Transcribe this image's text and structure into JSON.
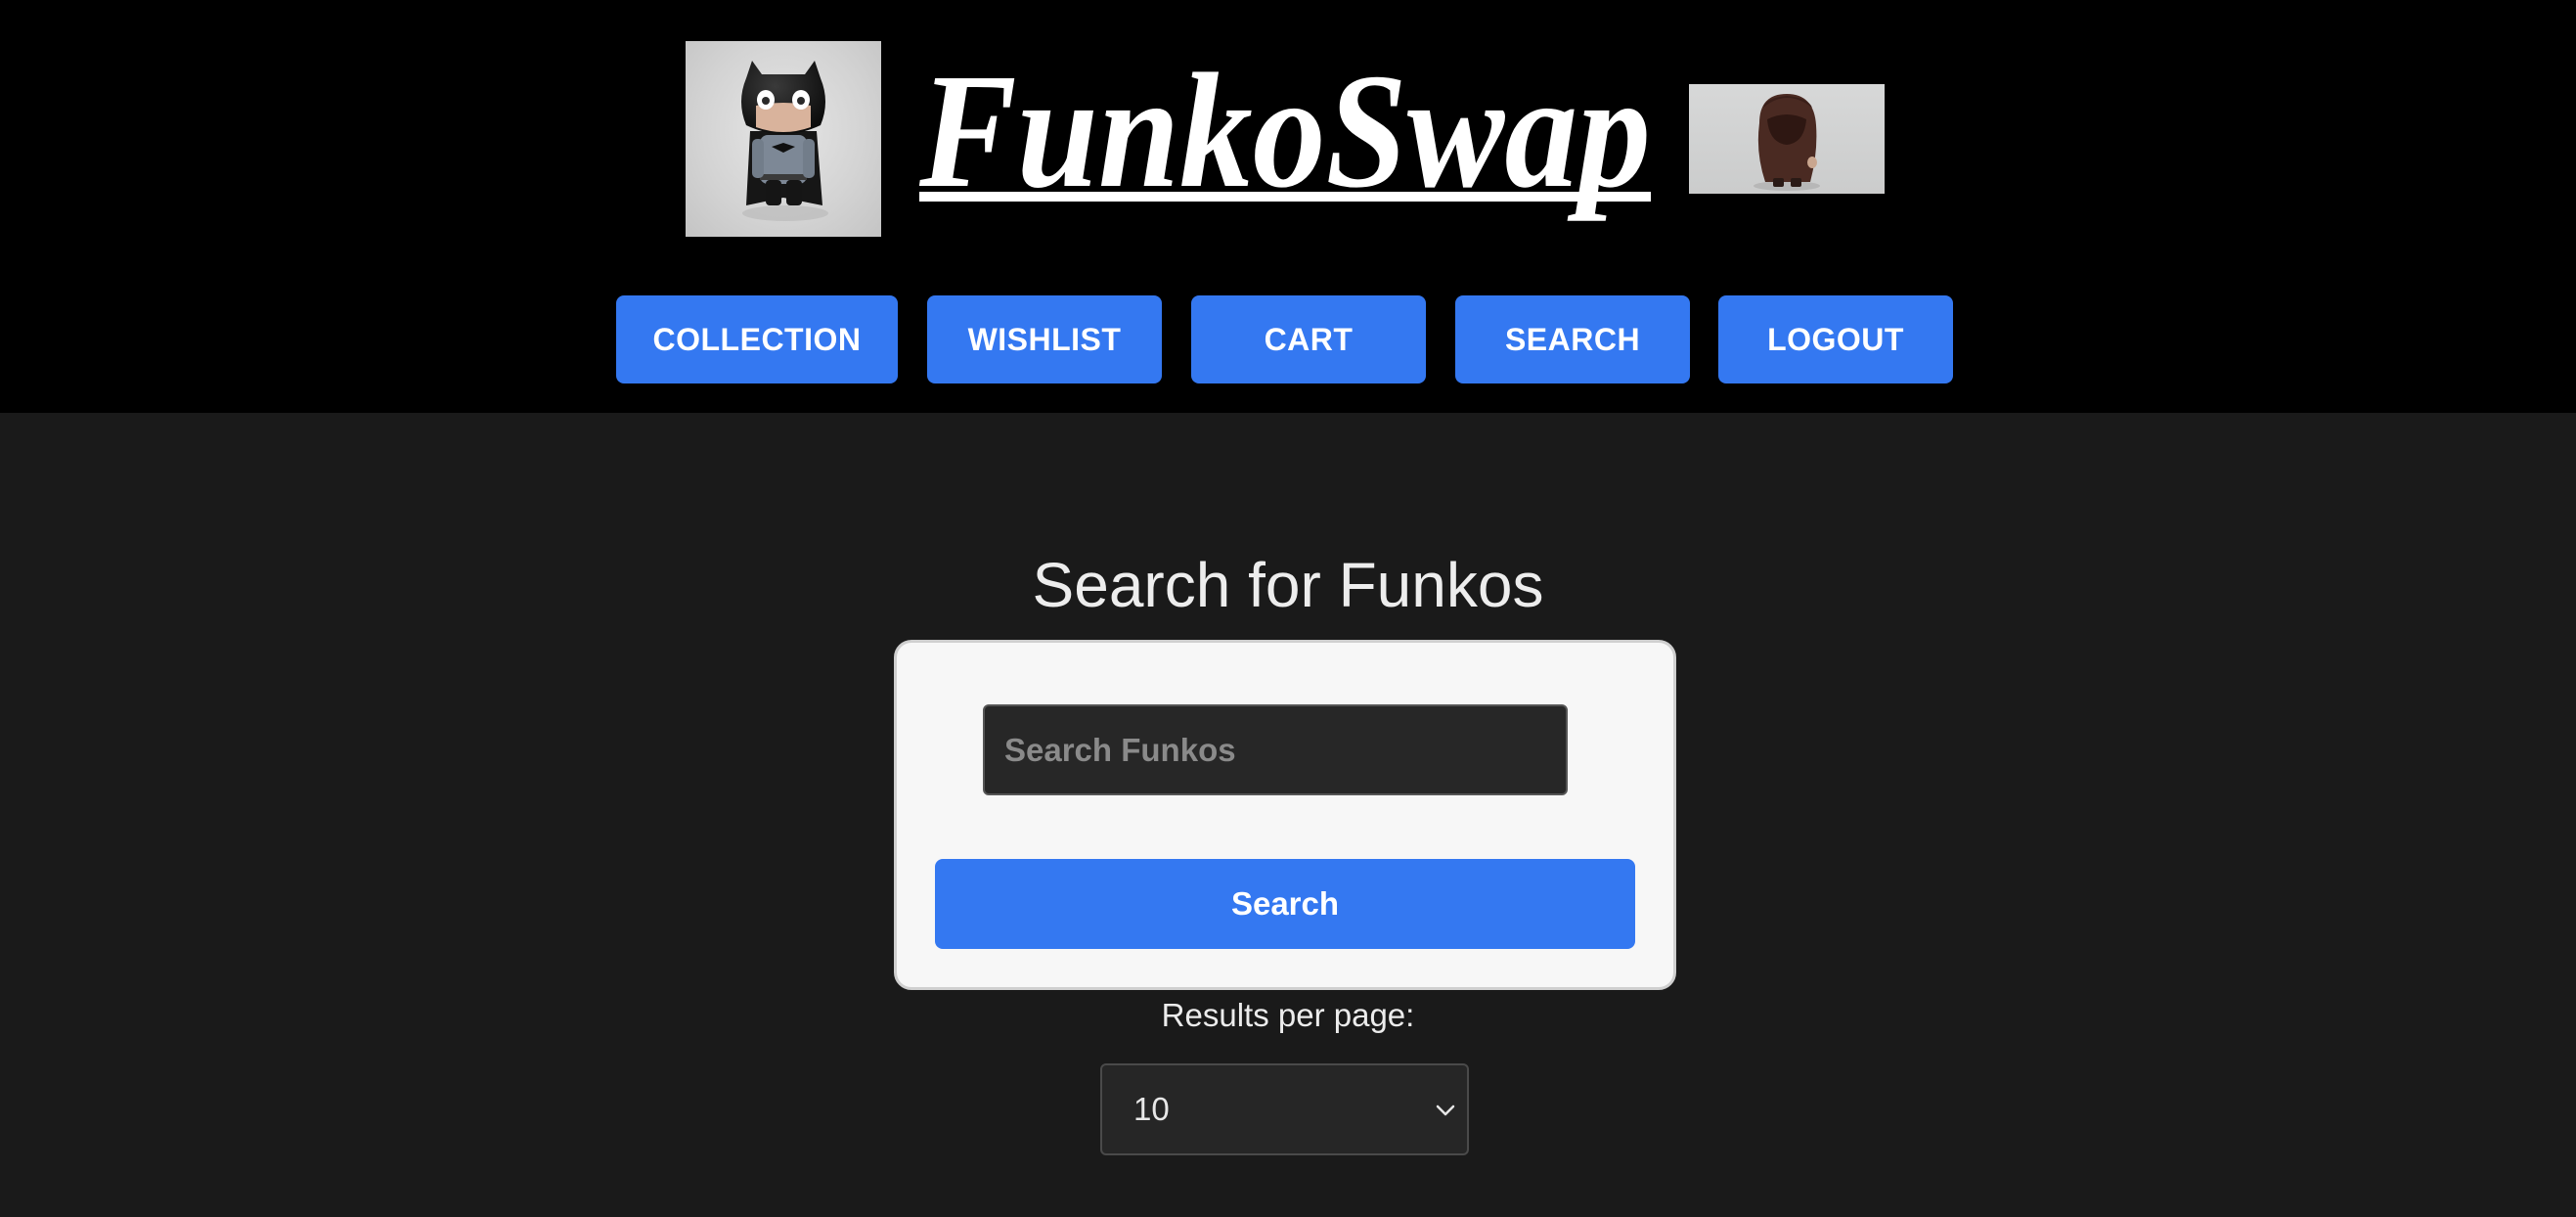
{
  "header": {
    "brand": "FunkoSwap",
    "left_image_alt": "Batman Funko Pop figure",
    "right_image_alt": "Brown hooded Funko figure"
  },
  "nav": {
    "collection": "COLLECTION",
    "wishlist": "WISHLIST",
    "cart": "CART",
    "search": "SEARCH",
    "logout": "LOGOUT"
  },
  "main": {
    "title": "Search for Funkos",
    "search_placeholder": "Search Funkos",
    "search_value": "",
    "search_button": "Search",
    "results_label": "Results per page:",
    "results_selected": "10"
  },
  "colors": {
    "header_bg": "#000000",
    "page_bg": "#1a1a1a",
    "accent": "#3478f1",
    "card_bg": "#f7f7f7"
  },
  "icons": {
    "select_arrow": "chevron-down-icon"
  }
}
